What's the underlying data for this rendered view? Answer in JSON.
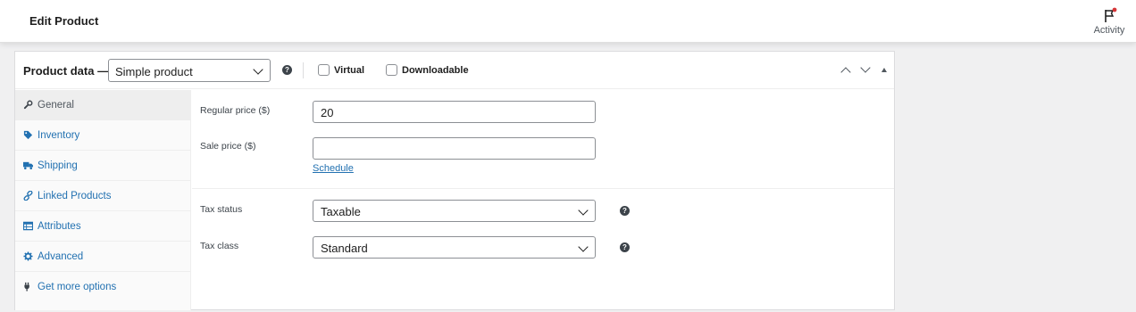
{
  "header": {
    "title": "Edit Product",
    "activity_label": "Activity"
  },
  "panel": {
    "title": "Product data —",
    "product_type": "Simple product",
    "virtual_label": "Virtual",
    "downloadable_label": "Downloadable"
  },
  "tabs": [
    {
      "label": "General",
      "icon": "wrench-icon",
      "active": true
    },
    {
      "label": "Inventory",
      "icon": "tag-icon"
    },
    {
      "label": "Shipping",
      "icon": "truck-icon"
    },
    {
      "label": "Linked Products",
      "icon": "link-icon"
    },
    {
      "label": "Attributes",
      "icon": "table-icon"
    },
    {
      "label": "Advanced",
      "icon": "gear-icon"
    },
    {
      "label": "Get more options",
      "icon": "plugin-icon"
    }
  ],
  "form": {
    "regular_price_label": "Regular price ($)",
    "regular_price_value": "20",
    "sale_price_label": "Sale price ($)",
    "sale_price_value": "",
    "schedule_link": "Schedule",
    "tax_status_label": "Tax status",
    "tax_status_value": "Taxable",
    "tax_class_label": "Tax class",
    "tax_class_value": "Standard"
  },
  "colors": {
    "link": "#2271b1",
    "activity_dot": "#d63638"
  }
}
